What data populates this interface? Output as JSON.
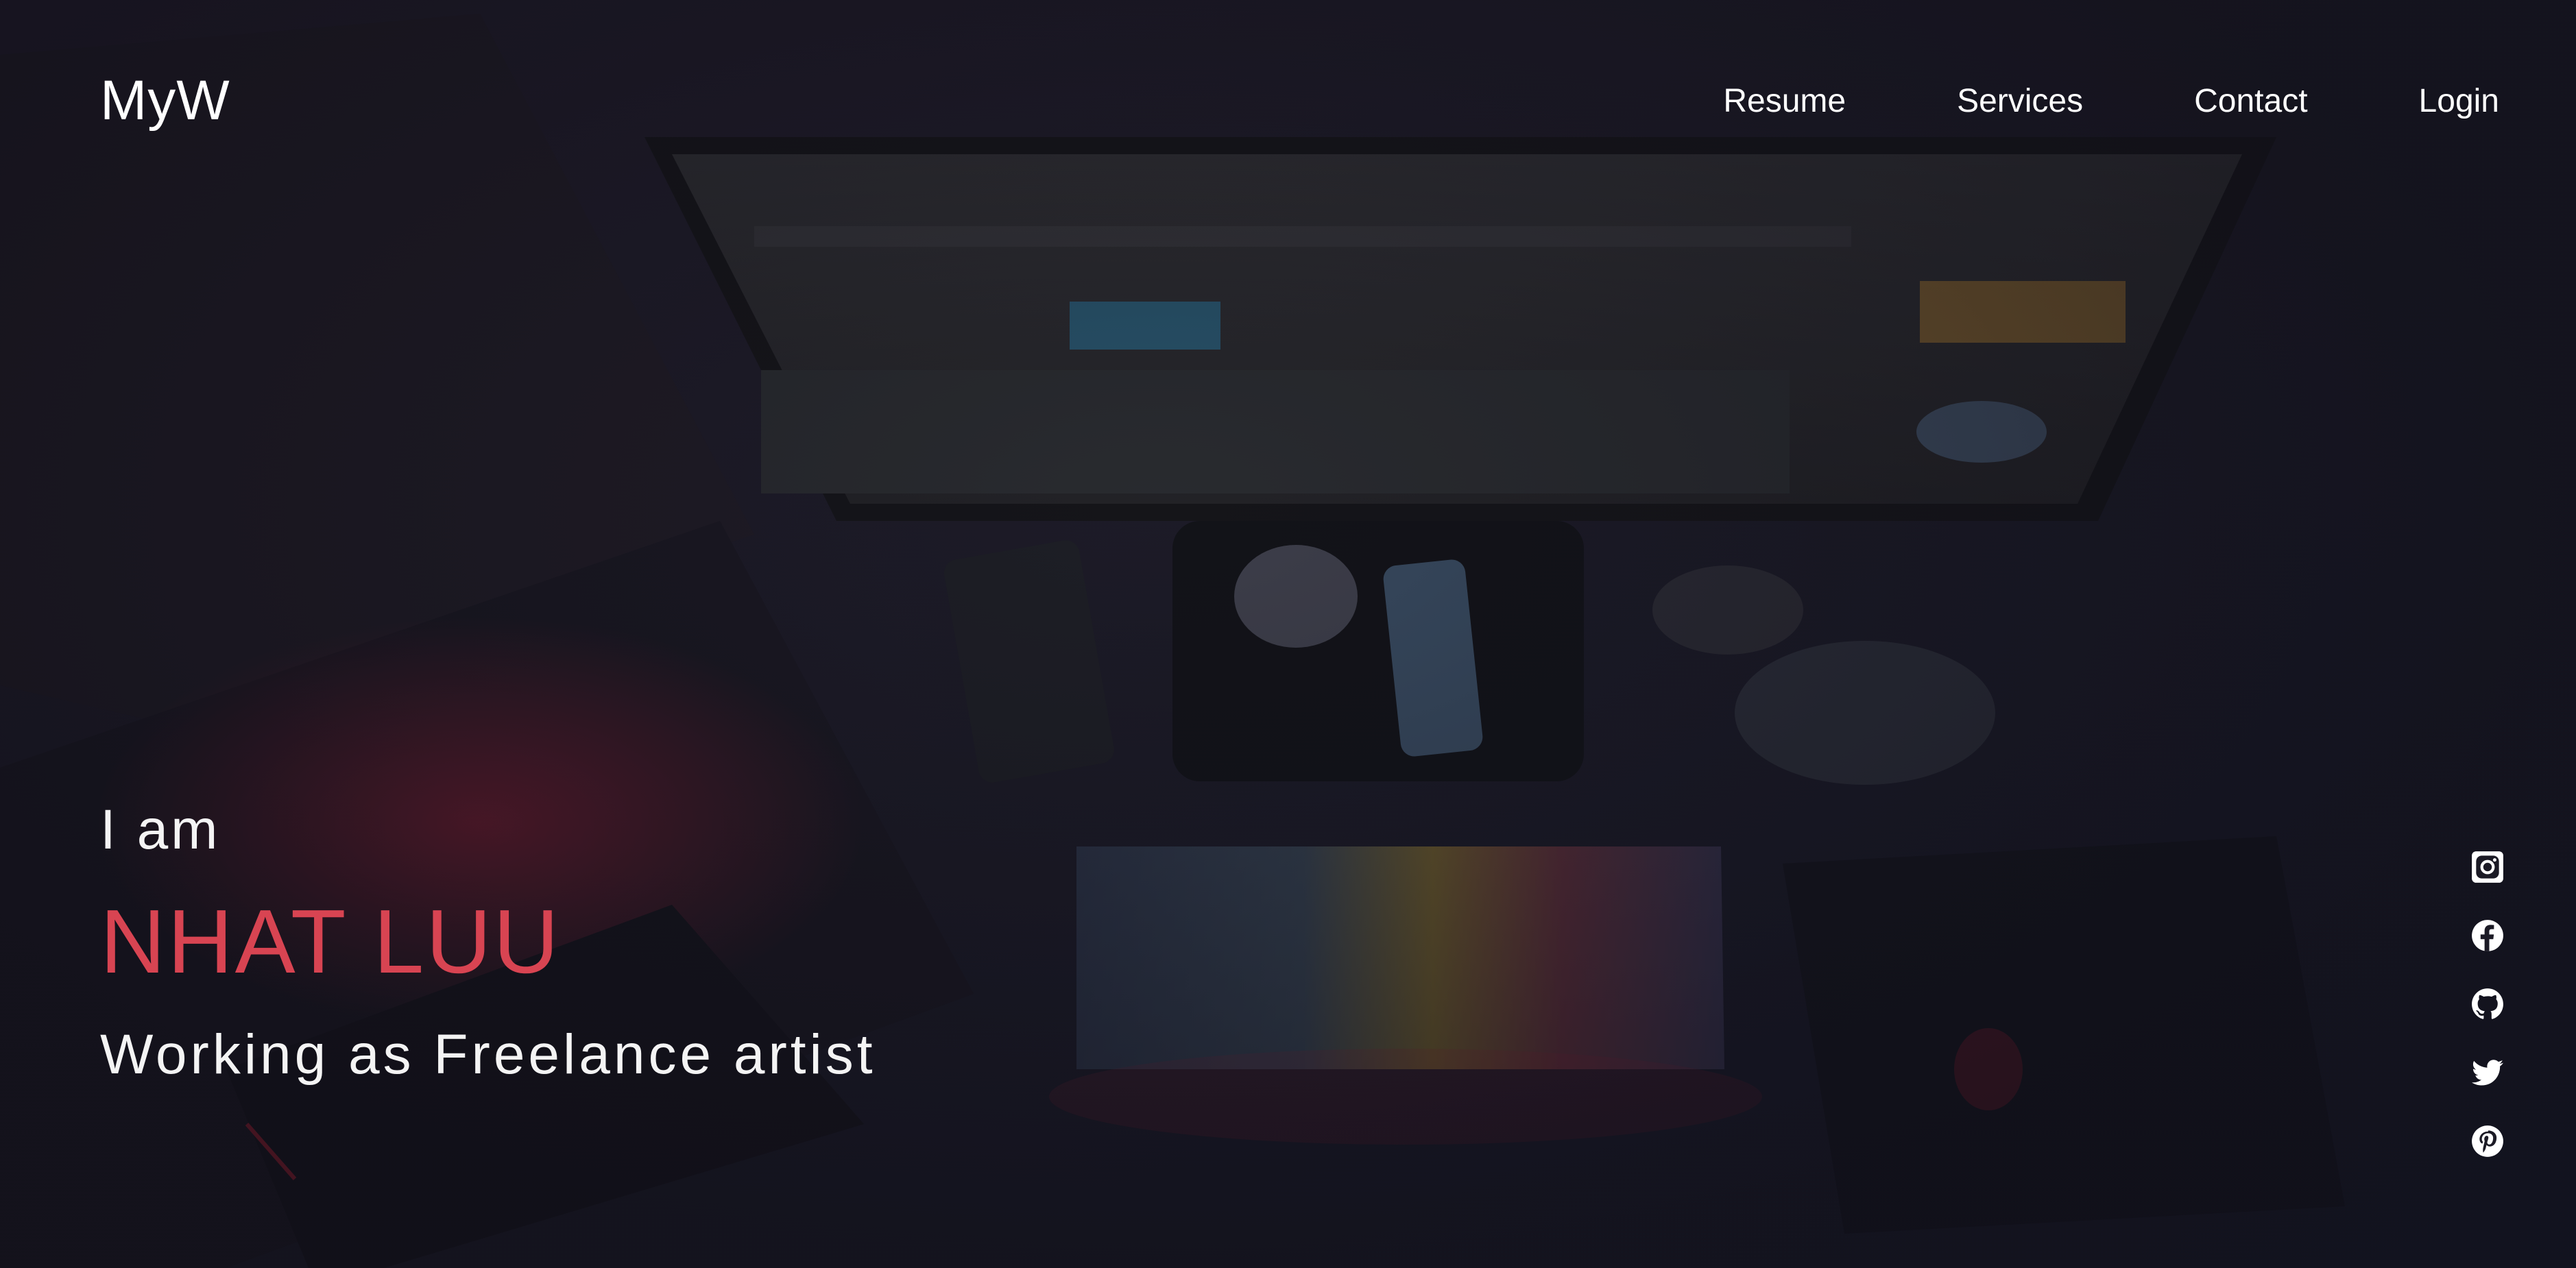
{
  "header": {
    "logo": "MyW",
    "nav": [
      {
        "label": "Resume"
      },
      {
        "label": "Services"
      },
      {
        "label": "Contact"
      },
      {
        "label": "Login"
      }
    ]
  },
  "hero": {
    "intro": "I am",
    "name": "NHAT LUU",
    "role": "Working as Freelance artist"
  },
  "social": [
    {
      "icon": "instagram-icon"
    },
    {
      "icon": "facebook-icon"
    },
    {
      "icon": "github-icon"
    },
    {
      "icon": "twitter-icon"
    },
    {
      "icon": "pinterest-icon"
    }
  ],
  "colors": {
    "accent": "#d84452",
    "text": "#f4f4f4",
    "background": "#1b1a25"
  }
}
